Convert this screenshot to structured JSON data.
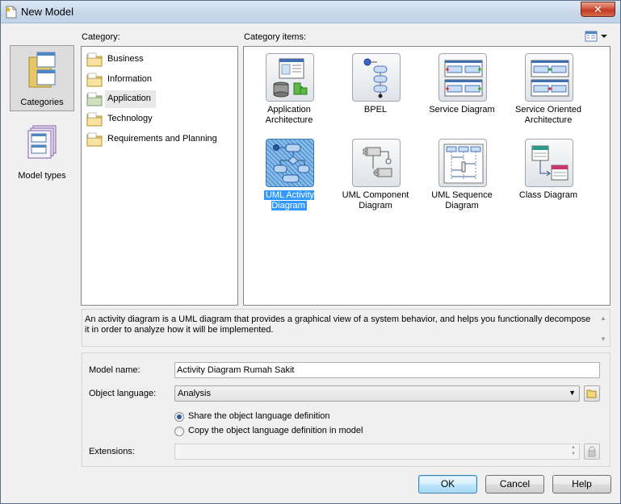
{
  "window": {
    "title": "New Model",
    "close_label": "✕"
  },
  "leftbar": [
    {
      "label": "Categories",
      "selected": true,
      "icon": "categories-icon"
    },
    {
      "label": "Model types",
      "selected": false,
      "icon": "model-types-icon"
    }
  ],
  "category": {
    "header": "Category:",
    "items": [
      {
        "label": "Business"
      },
      {
        "label": "Information"
      },
      {
        "label": "Application",
        "selected": true
      },
      {
        "label": "Technology"
      },
      {
        "label": "Requirements and Planning"
      }
    ]
  },
  "category_items": {
    "header": "Category items:",
    "view_icon": "view-options-icon",
    "tiles": [
      {
        "label": "Application Architecture",
        "icon": "application-architecture-icon"
      },
      {
        "label": "BPEL",
        "icon": "bpel-icon"
      },
      {
        "label": "Service Diagram",
        "icon": "service-diagram-icon"
      },
      {
        "label": "Service Oriented Architecture",
        "icon": "service-oriented-architecture-icon"
      },
      {
        "label": "UML Activity Diagram",
        "icon": "uml-activity-diagram-icon",
        "selected": true
      },
      {
        "label": "UML Component Diagram",
        "icon": "uml-component-diagram-icon"
      },
      {
        "label": "UML Sequence Diagram",
        "icon": "uml-sequence-diagram-icon"
      },
      {
        "label": "Class Diagram",
        "icon": "class-diagram-icon"
      }
    ]
  },
  "description": "An activity diagram is a UML diagram that provides a graphical view of a system behavior, and helps you functionally decompose it in order to analyze how it will be implemented.",
  "form": {
    "model_name_label": "Model name:",
    "model_name_value": "Activity Diagram Rumah Sakit",
    "object_language_label": "Object language:",
    "object_language_value": "Analysis",
    "radio_share": "Share the object language definition",
    "radio_copy": "Copy the object language definition in model",
    "extensions_label": "Extensions:",
    "extensions_value": ""
  },
  "buttons": {
    "ok": "OK",
    "cancel": "Cancel",
    "help": "Help"
  }
}
